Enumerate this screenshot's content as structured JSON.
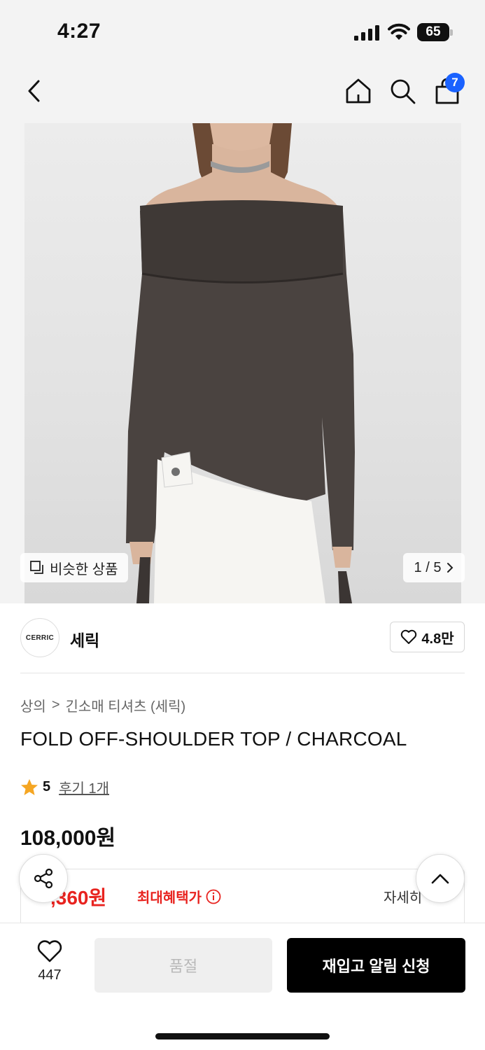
{
  "status_bar": {
    "time": "4:27",
    "battery": "65"
  },
  "nav": {
    "cart_badge": "7"
  },
  "gallery": {
    "similar_label": "비슷한 상품",
    "pager": "1 / 5"
  },
  "brand": {
    "logo_text": "CERRIC",
    "name": "세릭",
    "like_count": "4.8만"
  },
  "breadcrumb": {
    "category": "상의",
    "separator": ">",
    "subcategory": "긴소매 티셔츠 (세릭)"
  },
  "product": {
    "title": "FOLD OFF-SHOULDER TOP / CHARCOAL",
    "rating": "5",
    "reviews": "후기 1개",
    "price": "108,000원"
  },
  "benefit": {
    "price_partial": ",360원",
    "label": "최대혜택가",
    "detail_link": "자세히"
  },
  "bottom_bar": {
    "wish_count": "447",
    "soldout_label": "품절",
    "restock_label": "재입고 알림 신청"
  },
  "colors": {
    "accent_blue": "#1a62ff",
    "sale_red": "#e8231f",
    "garment": "#4a4340"
  },
  "icons": [
    "back-icon",
    "home-icon",
    "search-icon",
    "cart-icon",
    "similar-icon",
    "chevron-right-icon",
    "heart-icon",
    "star-icon",
    "info-icon",
    "share-icon",
    "chevron-up-icon"
  ]
}
